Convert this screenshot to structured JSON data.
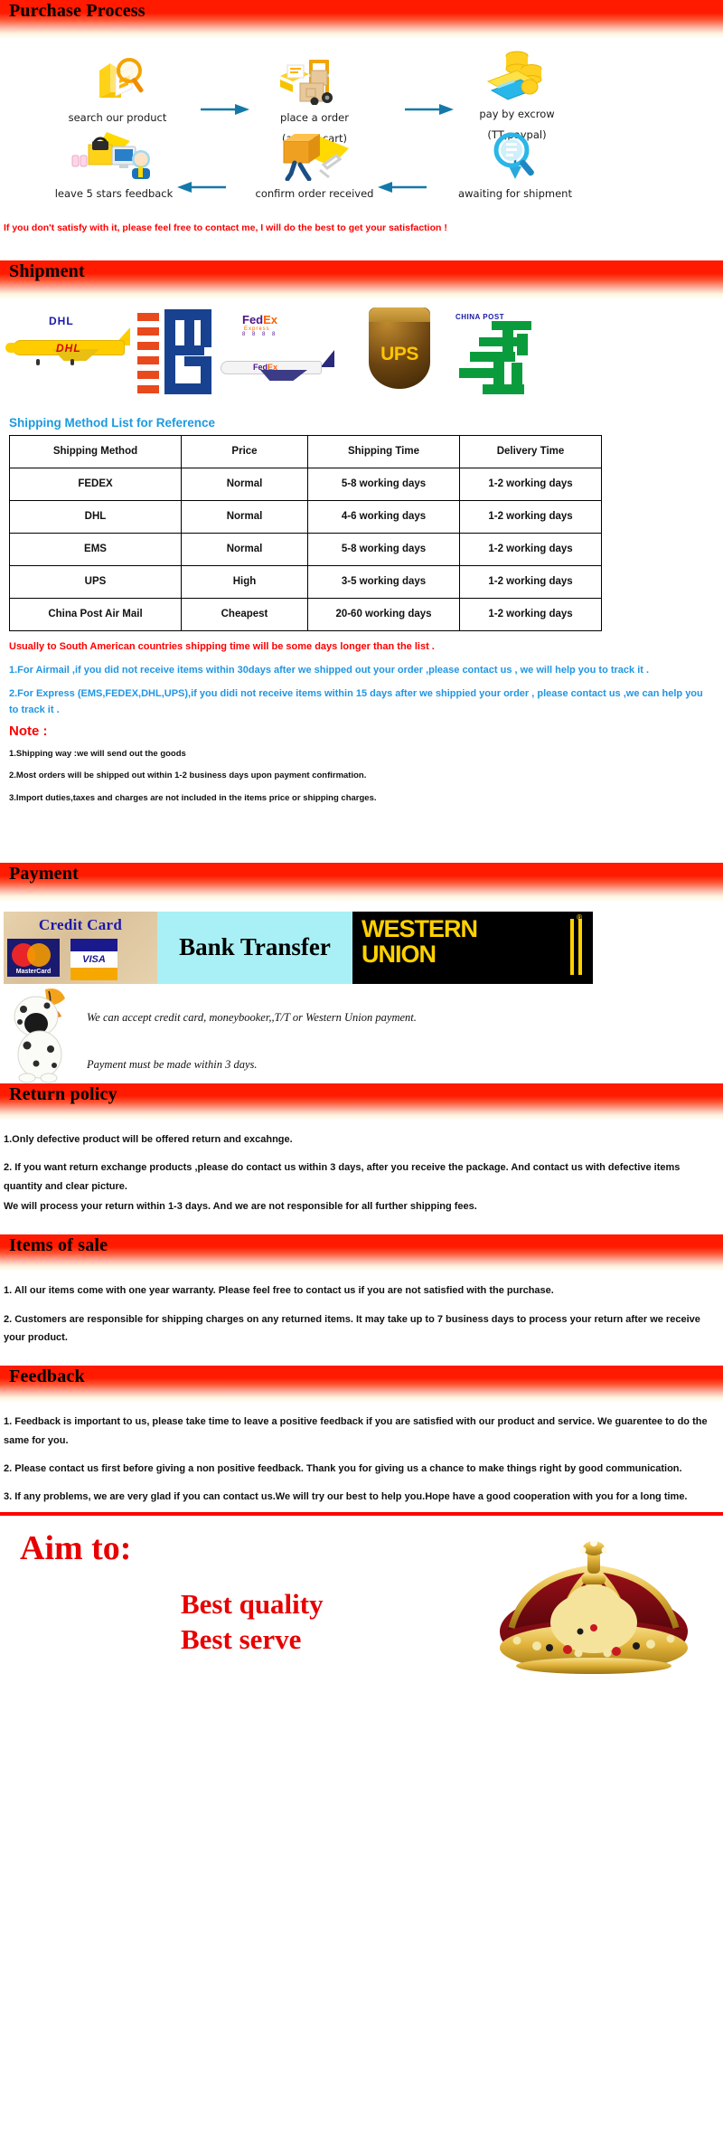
{
  "sections": {
    "purchase": {
      "title": "Purchase Process"
    },
    "shipment": {
      "title": "Shipment"
    },
    "payment": {
      "title": "Payment"
    },
    "return": {
      "title": "Return policy"
    },
    "items": {
      "title": "Items of sale"
    },
    "feedback": {
      "title": "Feedback"
    }
  },
  "purchase_flow": {
    "steps": [
      {
        "icon": "magnifier-product-icon",
        "label_line1": "search our product",
        "label_line2": ""
      },
      {
        "icon": "cart-boxes-icon",
        "label_line1": "place a order",
        "label_line2": "(add to cart)"
      },
      {
        "icon": "coins-card-icon",
        "label_line1": "pay by excrow",
        "label_line2": "(TT,paypal)"
      },
      {
        "icon": "shipment-wait-icon",
        "label_line1": "awaiting for shipment",
        "label_line2": ""
      },
      {
        "icon": "delivery-confirm-icon",
        "label_line1": "confirm order received",
        "label_line2": ""
      },
      {
        "icon": "feedback-stars-icon",
        "label_line1": "leave 5 stars feedback",
        "label_line2": ""
      }
    ],
    "footer_note": "If  you don't satisfy with it, please feel free to contact me, I will do the best to get your satisfaction !"
  },
  "carriers": [
    {
      "name": "DHL",
      "word": "DHL"
    },
    {
      "name": "EMS",
      "word": "EMS"
    },
    {
      "name": "FedEx",
      "word": "FedEx",
      "sub": "Express"
    },
    {
      "name": "UPS",
      "word": "UPS"
    },
    {
      "name": "China Post",
      "word": "CHINA POST"
    }
  ],
  "shipping": {
    "heading": "Shipping Method List for Reference",
    "columns": [
      "Shipping Method",
      "Price",
      "Shipping Time",
      "Delivery Time"
    ],
    "rows": [
      [
        "FEDEX",
        "Normal",
        "5-8 working days",
        "1-2 working days"
      ],
      [
        "DHL",
        "Normal",
        "4-6 working days",
        "1-2 working days"
      ],
      [
        "EMS",
        "Normal",
        "5-8 working days",
        "1-2 working days"
      ],
      [
        "UPS",
        "High",
        "3-5 working days",
        "1-2 working days"
      ],
      [
        "China Post Air Mail",
        "Cheapest",
        "20-60 working days",
        "1-2 working days"
      ]
    ],
    "red_note": "Usually to South American countries shipping time will be some days longer than the list .",
    "blue_note_1": "1.For Airmail ,if you did not receive items within 30days after we shipped out your order ,please contact us , we will help you to track it .",
    "blue_note_2": "2.For Express (EMS,FEDEX,DHL,UPS),if you didi not receive items within 15 days after we shippied your order , please contact us ,we can help you to track it .",
    "note_title": "Note :",
    "notes": [
      "1.Shipping way :we will send out the goods",
      "2.Most orders will be shipped out within 1-2 business days upon payment confirmation.",
      "3.Import duties,taxes and charges are not included in the items price or shipping charges."
    ]
  },
  "payment": {
    "logos": {
      "credit_card": "Credit Card",
      "mastercard": "MasterCard",
      "visa": "VISA",
      "bank_transfer": "Bank Transfer",
      "western_union_line1": "WESTERN",
      "western_union_line2": "UNION"
    },
    "line1": "We can accept credit card, moneybooker,,T/T or Western Union payment.",
    "line2": "Payment must be made within 3 days."
  },
  "return_policy": [
    "1.Only defective product will be offered return and excahnge.",
    "2. If you want return exchange products ,please do contact us within 3 days, after you receive the package. And contact us with defective items quantity and clear picture.",
    "We will process your return within 1-3 days. And we are not responsible for all further shipping fees."
  ],
  "items_of_sale": [
    "1. All our items come with one year warranty. Please feel free to contact us if you are not satisfied with the purchase.",
    "2. Customers are responsible for shipping charges on any returned items. It may take up to 7 business days to process your return after we receive your product."
  ],
  "feedback": [
    "1. Feedback is important to us, please take time to leave a positive feedback if you are satisfied with our product and service. We guarentee to do the same for you.",
    "2. Please contact us first before giving a non positive feedback. Thank you for giving us a chance to make things right by good communication.",
    "3. If any problems, we are very glad if you can contact us.We will try our best to help you.Hope have a good cooperation with you for a long time."
  ],
  "footer": {
    "aim": "Aim to:",
    "quality": "Best quality",
    "serve": "Best serve"
  },
  "colors": {
    "banner_red": "#ff1a00",
    "accent_blue": "#1b9ae0",
    "alert_red": "#ff0000",
    "arrow_blue": "#1479a8",
    "gold": "#ffcc00"
  }
}
